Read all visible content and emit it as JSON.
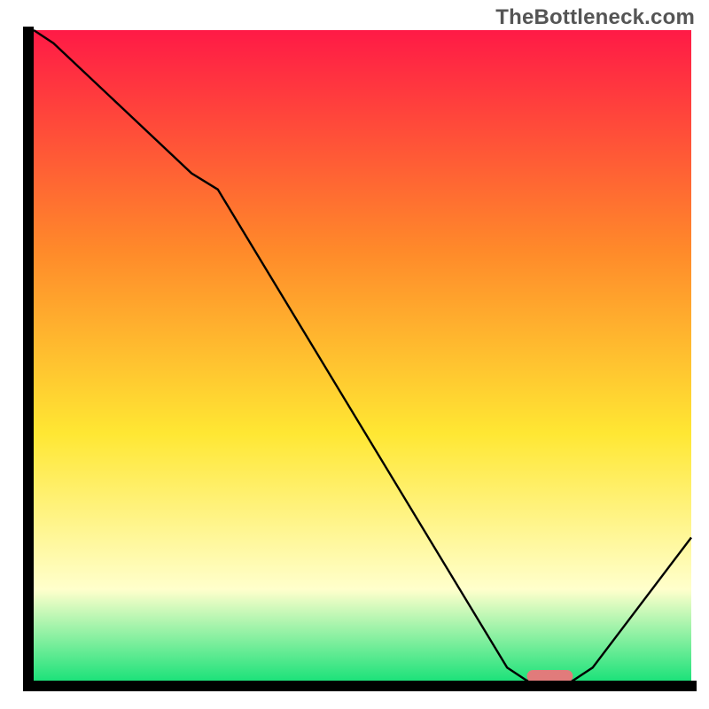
{
  "watermark": "TheBottleneck.com",
  "colors": {
    "axis": "#000000",
    "curve": "#000000",
    "marker_fill": "#e17b7b",
    "gradient_top": "#ff1a46",
    "gradient_mid_orange": "#ff8a2a",
    "gradient_mid_yellow": "#ffe733",
    "gradient_paleyellow": "#ffffcc",
    "gradient_green": "#1de27a"
  },
  "chart_data": {
    "type": "line",
    "title": "",
    "xlabel": "",
    "ylabel": "",
    "xlim": [
      0,
      100
    ],
    "ylim": [
      0,
      100
    ],
    "x": [
      0,
      3,
      24,
      28,
      72,
      75,
      82,
      85,
      100
    ],
    "values": [
      100,
      98,
      78,
      75.5,
      2,
      0,
      0,
      2,
      22
    ],
    "optimum_range_x": [
      75,
      82
    ],
    "notes": "V-shaped bottleneck curve; flat minimum highlighted by rounded marker"
  }
}
